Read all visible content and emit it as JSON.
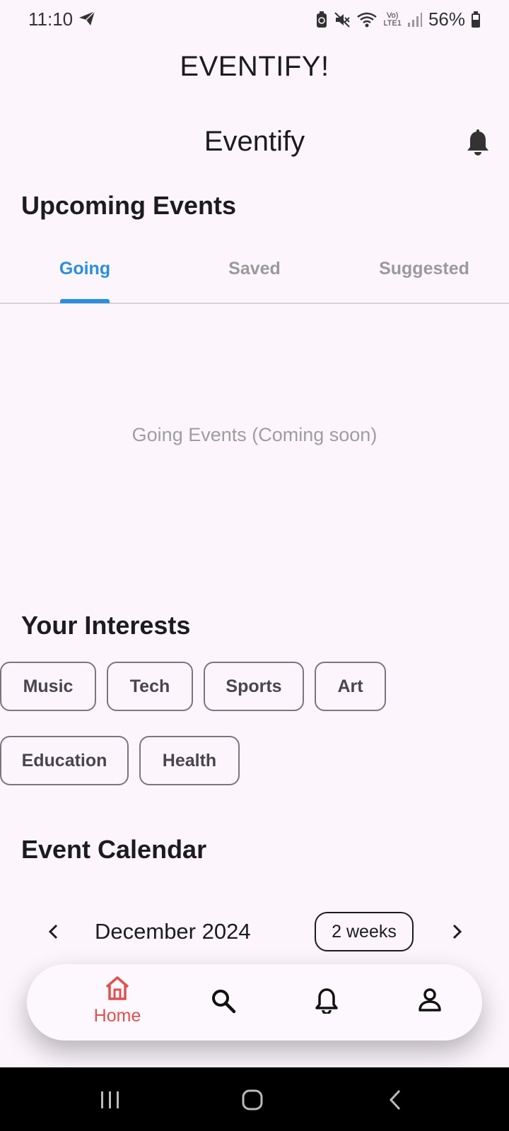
{
  "status_bar": {
    "time": "11:10",
    "battery": "56%",
    "network_label": "LTE1"
  },
  "app_title": "EVENTIFY!",
  "appbar": {
    "title": "Eventify"
  },
  "upcoming": {
    "title": "Upcoming Events",
    "tabs": [
      {
        "label": "Going",
        "active": true
      },
      {
        "label": "Saved",
        "active": false
      },
      {
        "label": "Suggested",
        "active": false
      }
    ],
    "empty_text": "Going Events (Coming soon)"
  },
  "interests": {
    "title": "Your Interests",
    "chips": [
      "Music",
      "Tech",
      "Sports",
      "Art",
      "Education",
      "Health"
    ]
  },
  "calendar": {
    "title": "Event Calendar",
    "month": "December 2024",
    "format_button": "2 weeks"
  },
  "bottom_nav": {
    "items": [
      {
        "label": "Home",
        "icon": "home-icon",
        "active": true
      },
      {
        "label": "",
        "icon": "search-icon",
        "active": false
      },
      {
        "label": "",
        "icon": "bell-icon",
        "active": false
      },
      {
        "label": "",
        "icon": "person-icon",
        "active": false
      }
    ]
  },
  "colors": {
    "background": "#fcf6fc",
    "tab_active": "#2a8fdc",
    "nav_active": "#e0504f",
    "chip_border": "#7b757f"
  }
}
